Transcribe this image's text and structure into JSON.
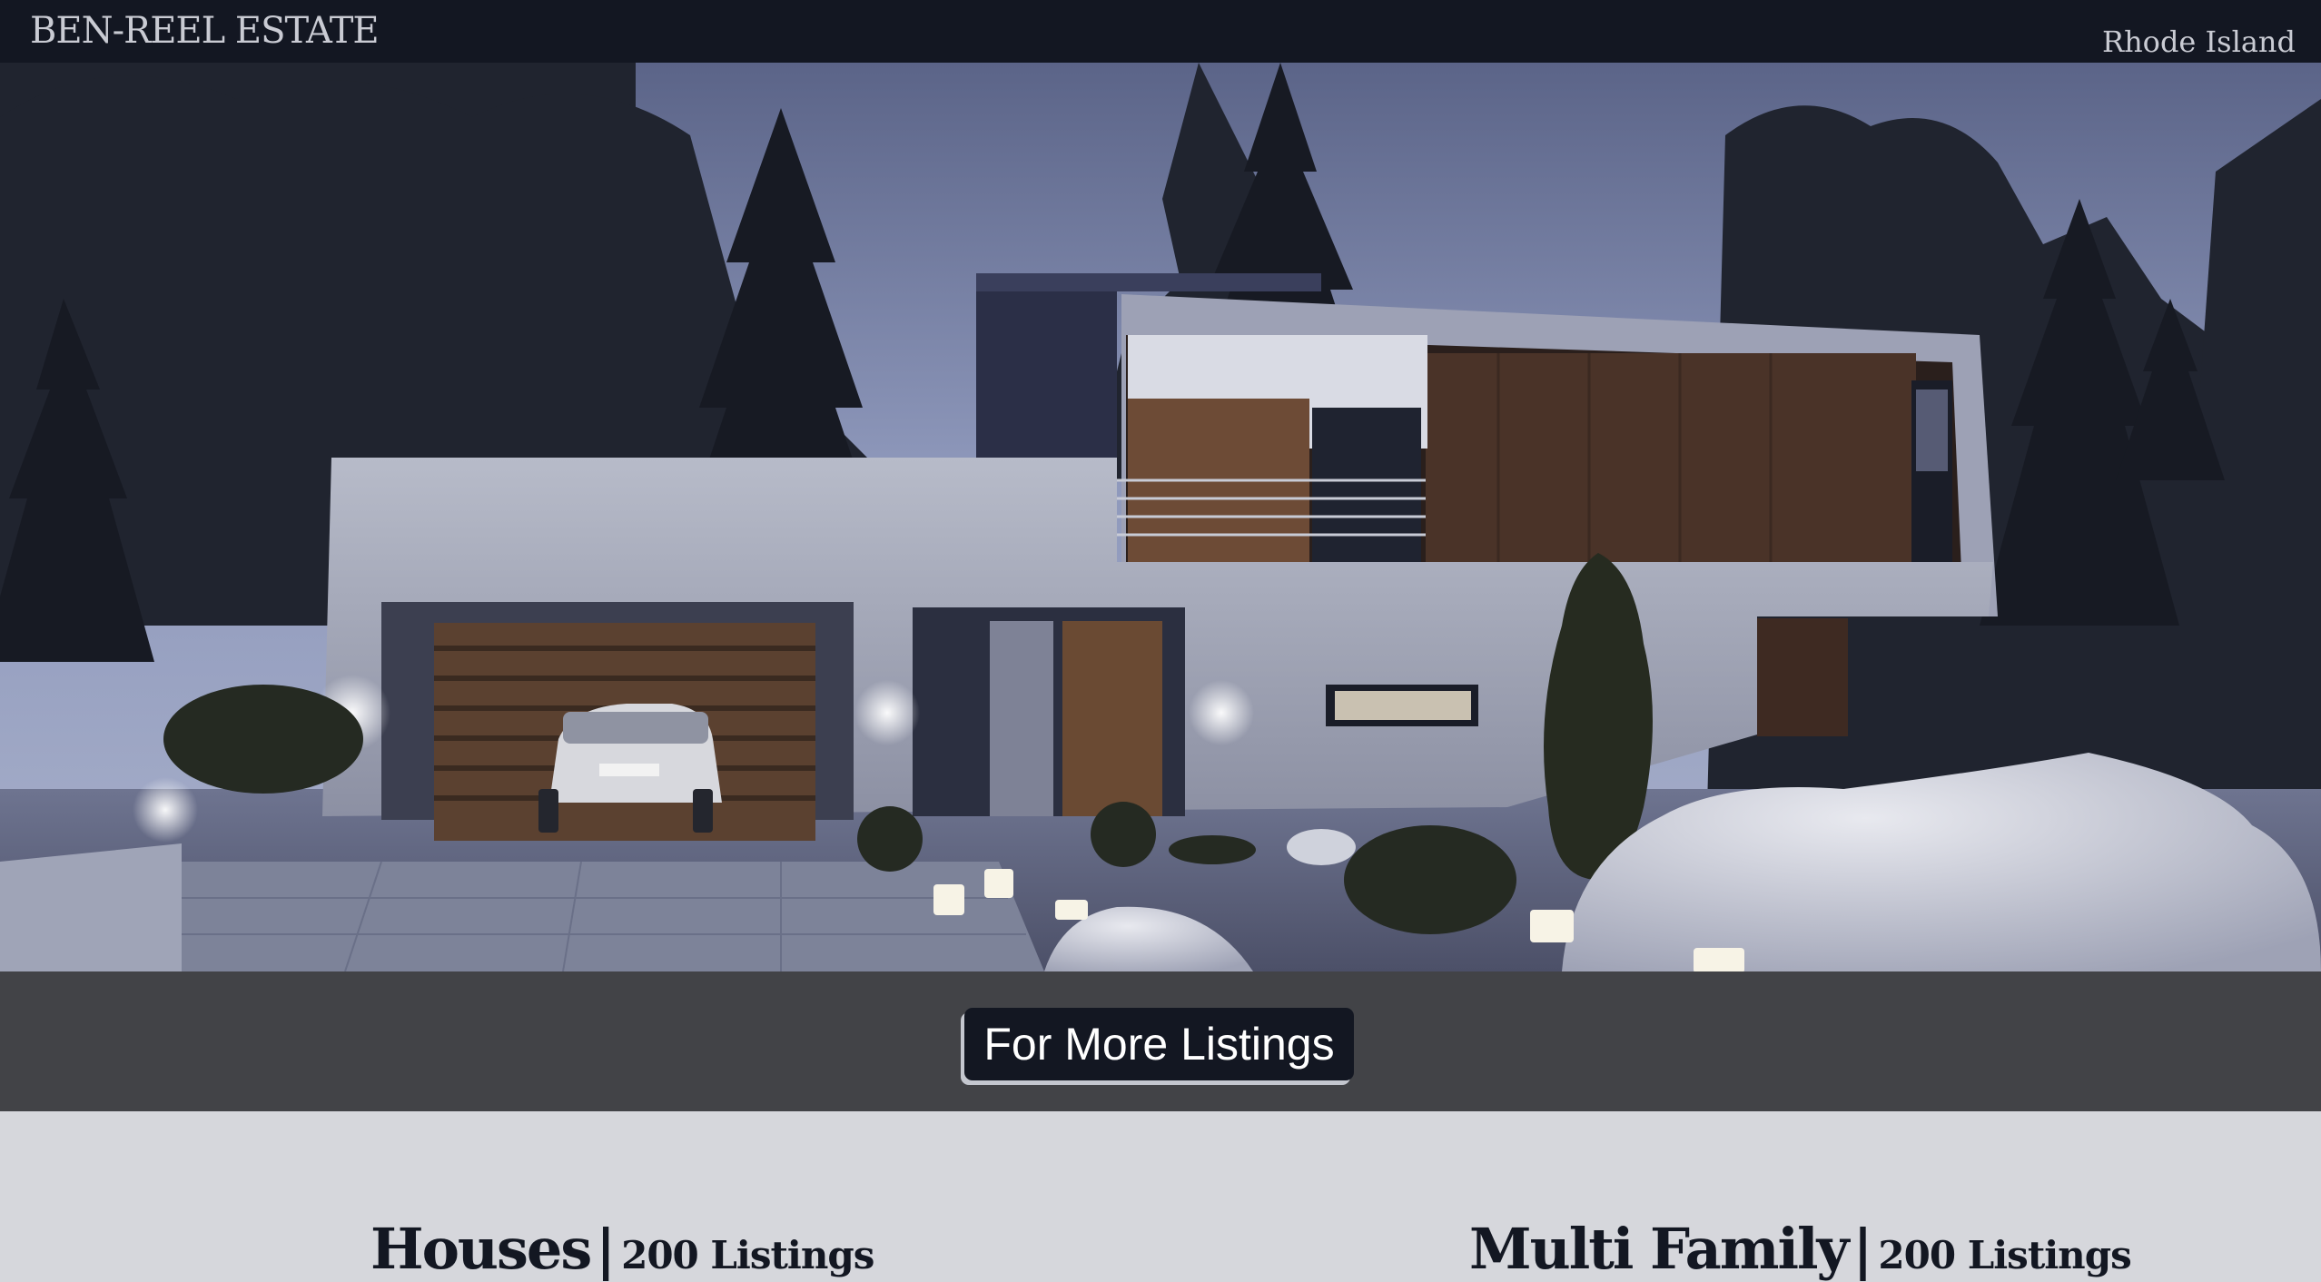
{
  "header": {
    "brand": "BEN-REEL ESTATE",
    "region": "Rhode Island"
  },
  "hero": {
    "icon": "modern-house-night-photo"
  },
  "cta": {
    "label": "For More Listings"
  },
  "categories": [
    {
      "name": "Houses",
      "separator": "|",
      "count": "200 Listings"
    },
    {
      "name": "Multi Family",
      "separator": "|",
      "count": "200 Listings"
    }
  ],
  "colors": {
    "nav_bg": "#131722",
    "nav_text": "#c9cbd3",
    "cta_band": "#424347",
    "cta_button": "#131722",
    "page_bg": "#d6d7dc",
    "heading": "#131722"
  }
}
